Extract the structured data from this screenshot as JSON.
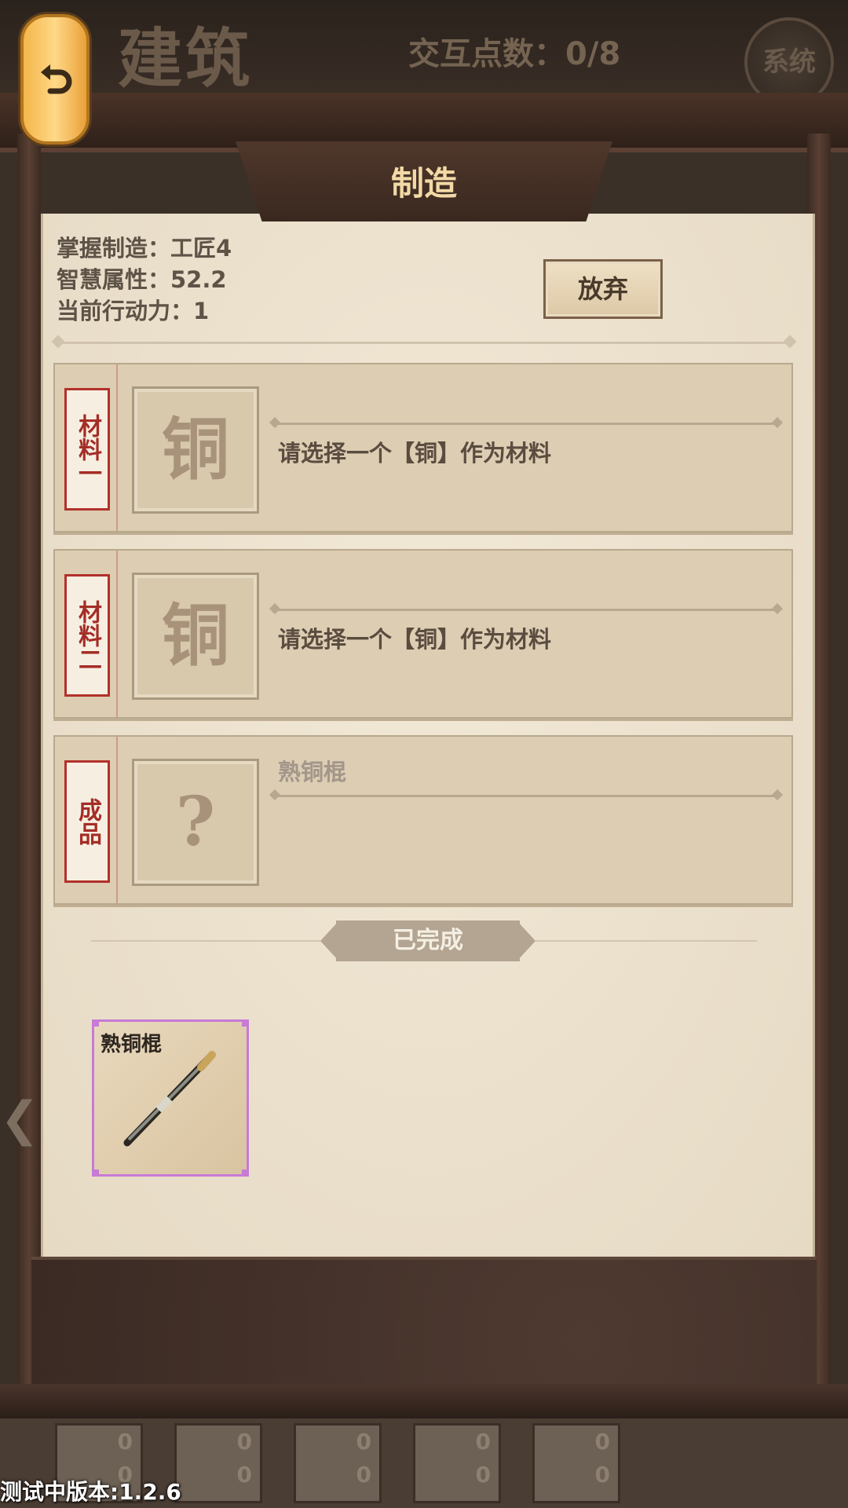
{
  "header": {
    "page_title": "建筑",
    "interaction_points": "交互点数：0/8",
    "system_button": "系统",
    "back_icon": "undo-arrow-icon"
  },
  "panel": {
    "title": "制造",
    "stats": {
      "mastered": "掌握制造：工匠4",
      "wisdom": "智慧属性：52.2",
      "action_points": "当前行动力：1"
    },
    "give_up_button": "放弃"
  },
  "slots": [
    {
      "tag": "材料一",
      "icon_char": "铜",
      "text": "请选择一个【铜】作为材料"
    },
    {
      "tag": "材料二",
      "icon_char": "铜",
      "text": "请选择一个【铜】作为材料"
    },
    {
      "tag": "成品",
      "icon_char": "?",
      "text": "熟铜棍"
    }
  ],
  "completed": {
    "label": "已完成",
    "items": [
      {
        "name": "熟铜棍",
        "icon": "copper-staff-icon"
      }
    ]
  },
  "bottom_units": [
    {
      "top": "0",
      "bottom": "0"
    },
    {
      "top": "0",
      "bottom": "0"
    },
    {
      "top": "0",
      "bottom": "0"
    },
    {
      "top": "0",
      "bottom": "0"
    },
    {
      "top": "0",
      "bottom": "0"
    }
  ],
  "version": "测试中版本:1.2.6",
  "colors": {
    "accent_red": "#b3312b",
    "rarity_purple": "#c77ad6",
    "title_gold": "#f2d9a6"
  }
}
